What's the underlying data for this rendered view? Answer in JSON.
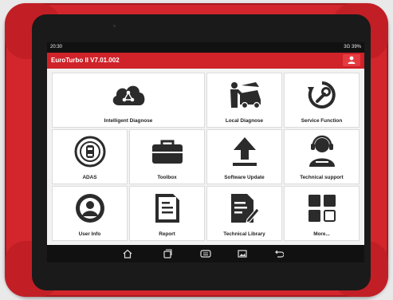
{
  "status": {
    "time": "20:30",
    "signal": "3G",
    "battery": "39%"
  },
  "app": {
    "title": "EuroTurbo II V7.01.002"
  },
  "tiles": [
    {
      "label": "Intelligent Diagnose",
      "icon": "cloud-network-icon"
    },
    {
      "label": "Local Diagnose",
      "icon": "mechanic-car-icon"
    },
    {
      "label": "Service Function",
      "icon": "wrench-cycle-icon"
    },
    {
      "label": "ADAS",
      "icon": "car-sensor-icon"
    },
    {
      "label": "Toolbox",
      "icon": "toolbox-icon"
    },
    {
      "label": "Software Update",
      "icon": "upload-arrow-icon"
    },
    {
      "label": "Technical support",
      "icon": "headset-support-icon"
    },
    {
      "label": "User Info",
      "icon": "user-avatar-icon"
    },
    {
      "label": "Report",
      "icon": "report-document-icon"
    },
    {
      "label": "Technical Library",
      "icon": "library-edit-icon"
    },
    {
      "label": "More...",
      "icon": "grid-more-icon"
    }
  ],
  "colors": {
    "brand_red": "#cf2229",
    "housing_red": "#d2262c",
    "icon_dark": "#2b2b2b"
  }
}
